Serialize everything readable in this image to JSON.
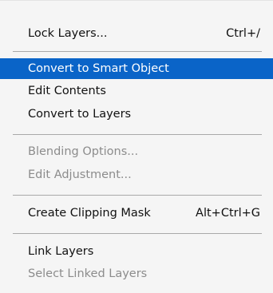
{
  "menu": {
    "items": [
      {
        "label": "Lock Layers...",
        "shortcut": "Ctrl+/",
        "state": "enabled"
      },
      {
        "label": "Convert to Smart Object",
        "shortcut": "",
        "state": "selected"
      },
      {
        "label": "Edit Contents",
        "shortcut": "",
        "state": "enabled"
      },
      {
        "label": "Convert to Layers",
        "shortcut": "",
        "state": "enabled"
      },
      {
        "label": "Blending Options...",
        "shortcut": "",
        "state": "disabled"
      },
      {
        "label": "Edit Adjustment...",
        "shortcut": "",
        "state": "disabled"
      },
      {
        "label": "Create Clipping Mask",
        "shortcut": "Alt+Ctrl+G",
        "state": "enabled"
      },
      {
        "label": "Link Layers",
        "shortcut": "",
        "state": "enabled"
      },
      {
        "label": "Select Linked Layers",
        "shortcut": "",
        "state": "disabled"
      }
    ]
  },
  "colors": {
    "highlight": "#0a64c8",
    "disabled_text": "#8c8c8c",
    "menu_background": "#f5f5f5"
  }
}
